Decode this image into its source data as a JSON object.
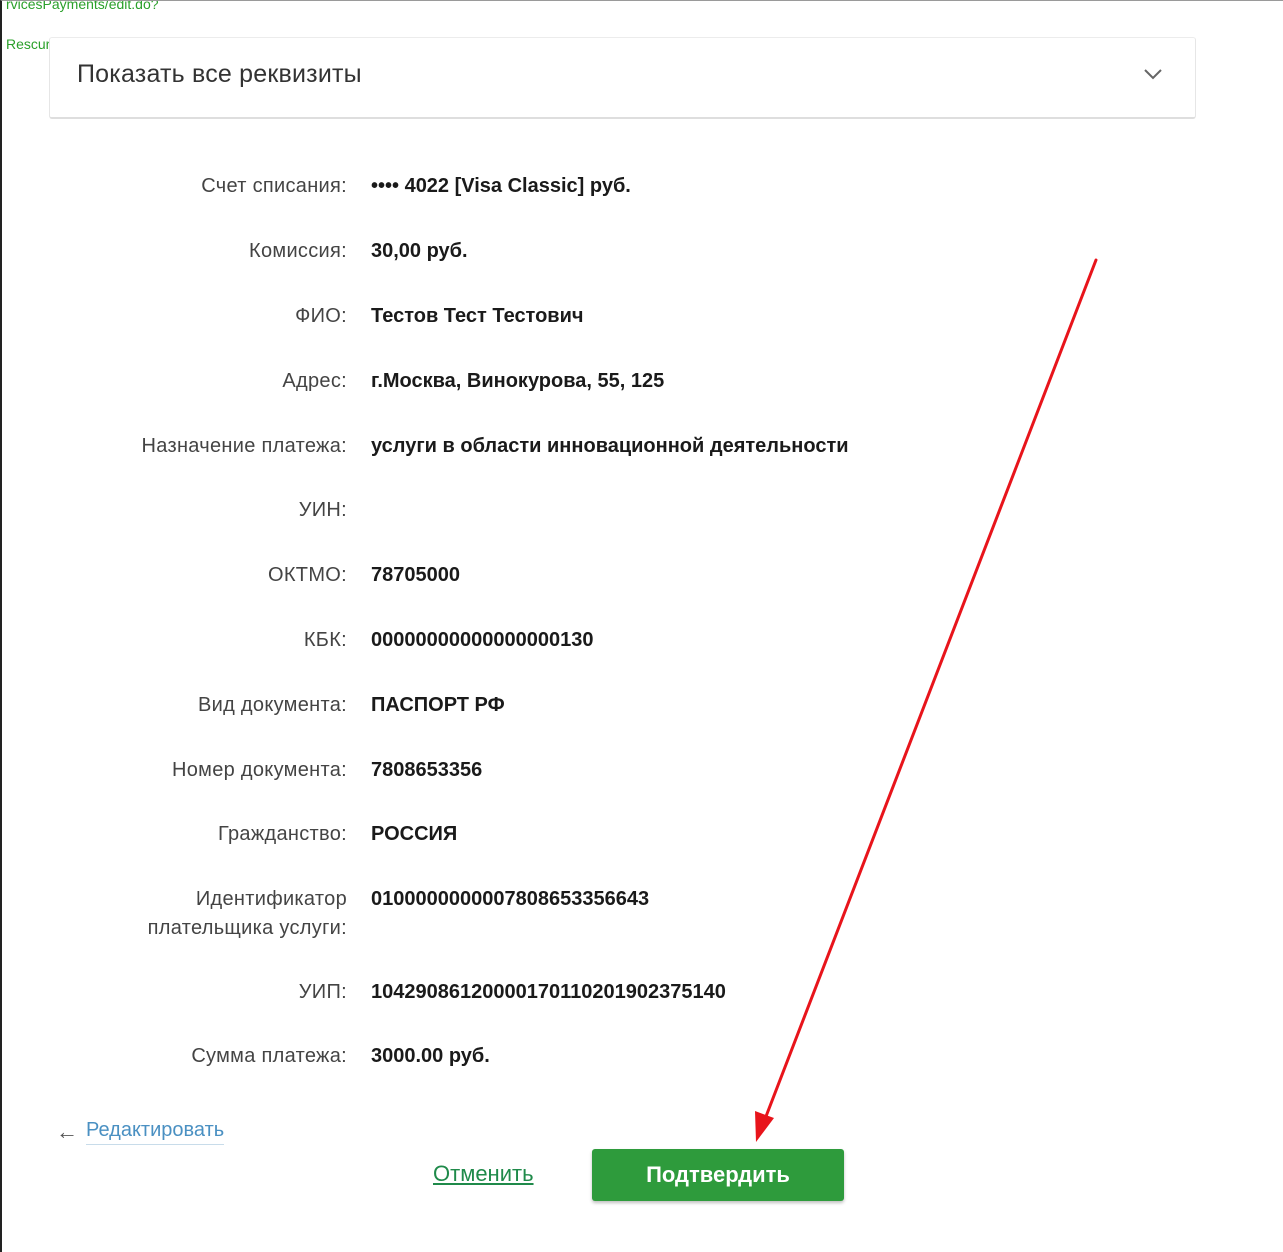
{
  "code_snippet": {
    "line1": "rvicesPayments/edit.do?",
    "line2": "Rescurce=&')\">"
  },
  "details_toggle": {
    "label": "Показать все реквизиты",
    "icon": "chevron-down-icon"
  },
  "fields": [
    {
      "label": "Счет списания:",
      "value": "•••• 4022  [Visa Classic]  руб."
    },
    {
      "label": "Комиссия:",
      "value": "30,00 руб."
    },
    {
      "label": "ФИО:",
      "value": "Тестов Тест Тестович"
    },
    {
      "label": "Адрес:",
      "value": "г.Москва, Винокурова, 55, 125"
    },
    {
      "label": "Назначение платежа:",
      "value": "услуги в области инновационной деятельности"
    },
    {
      "label": "УИН:",
      "value": ""
    },
    {
      "label": "ОКТМО:",
      "value": "78705000"
    },
    {
      "label": "КБК:",
      "value": "00000000000000000130"
    },
    {
      "label": "Вид документа:",
      "value": "ПАСПОРТ РФ"
    },
    {
      "label": "Номер документа:",
      "value": "7808653356"
    },
    {
      "label": "Гражданство:",
      "value": "РОССИЯ"
    },
    {
      "label_line1": "Идентификатор",
      "label_line2": "плательщика услуги:",
      "value": "0100000000007808653356643"
    },
    {
      "label": "УИП:",
      "value": "10429086120000170110201902375140"
    },
    {
      "label": "Сумма платежа:",
      "value": "3000.00 руб."
    }
  ],
  "actions": {
    "edit_arrow": "←",
    "edit_label": "Редактировать",
    "cancel_label": "Отменить",
    "confirm_label": "Подтвердить"
  },
  "colors": {
    "confirm_button": "#2e9b3c",
    "cancel_link": "#1f8a4a",
    "edit_link": "#4a90c2",
    "annotation_arrow": "#e8141b"
  }
}
